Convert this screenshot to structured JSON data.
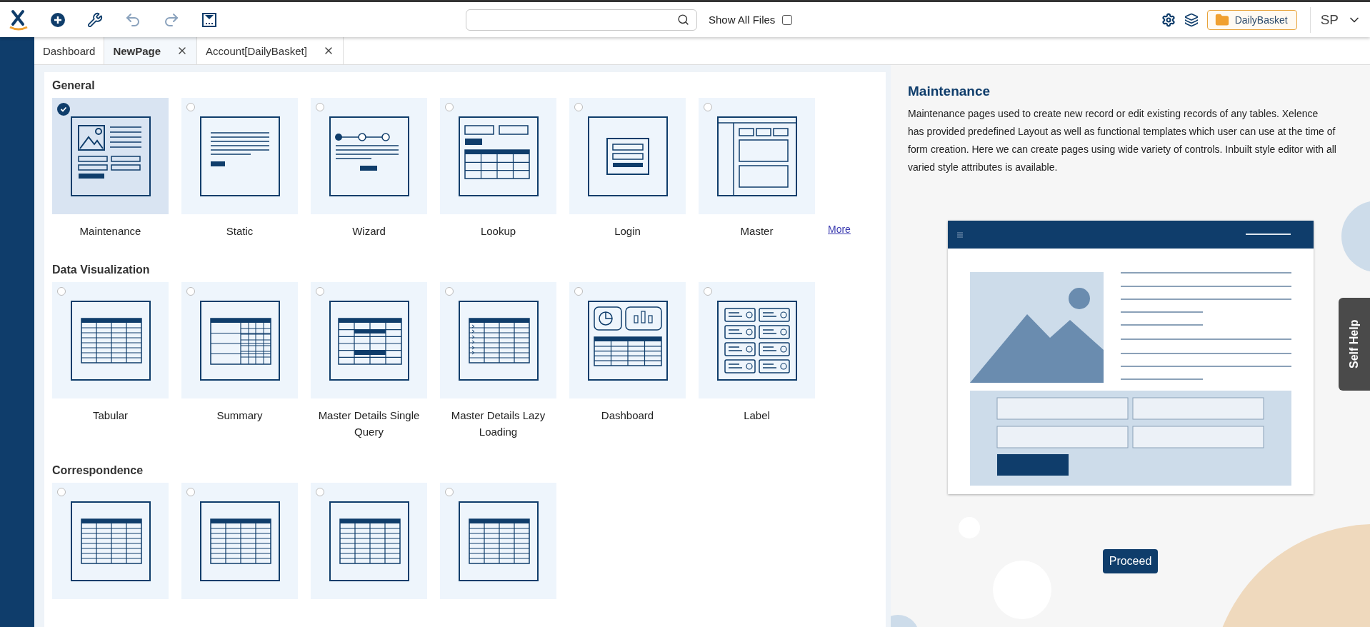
{
  "toolbar": {
    "show_all_files": {
      "label": "Show All Files",
      "checked": false
    },
    "project": "DailyBasket",
    "user": "SP"
  },
  "tabs": [
    {
      "label": "Dashboard",
      "selected": false,
      "closable": false
    },
    {
      "label": "NewPage",
      "selected": true,
      "closable": true
    },
    {
      "label": "Account[DailyBasket]",
      "selected": false,
      "closable": true
    }
  ],
  "sections": [
    {
      "title": "General",
      "more": "More",
      "templates": [
        {
          "name": "Maintenance",
          "kind": "maintenance",
          "selected": true
        },
        {
          "name": "Static",
          "kind": "static",
          "selected": false
        },
        {
          "name": "Wizard",
          "kind": "wizard",
          "selected": false
        },
        {
          "name": "Lookup",
          "kind": "lookup",
          "selected": false
        },
        {
          "name": "Login",
          "kind": "login",
          "selected": false
        },
        {
          "name": "Master",
          "kind": "master",
          "selected": false
        }
      ]
    },
    {
      "title": "Data Visualization",
      "templates": [
        {
          "name": "Tabular",
          "kind": "table",
          "selected": false
        },
        {
          "name": "Summary",
          "kind": "summary",
          "selected": false
        },
        {
          "name": "Master Details Single Query",
          "kind": "detail",
          "selected": false
        },
        {
          "name": "Master Details Lazy Loading",
          "kind": "lazy",
          "selected": false
        },
        {
          "name": "Dashboard",
          "kind": "dashboard",
          "selected": false
        },
        {
          "name": "Label",
          "kind": "label",
          "selected": false
        }
      ]
    },
    {
      "title": "Correspondence",
      "templates": [
        {
          "kind": "table",
          "selected": false
        },
        {
          "kind": "table",
          "selected": false
        },
        {
          "kind": "table",
          "selected": false
        },
        {
          "kind": "table",
          "selected": false
        }
      ]
    }
  ],
  "details": {
    "title": "Maintenance",
    "description": "Maintenance pages used to create new record or edit existing records of any tables. Xelence has provided predefined Layout as well as functional templates which user can use at the time of form creation. Here we can create pages using wide variety of controls. Inbuilt style editor with all varied style attributes is available.",
    "proceed": "Proceed"
  },
  "self_help": "Self Help"
}
